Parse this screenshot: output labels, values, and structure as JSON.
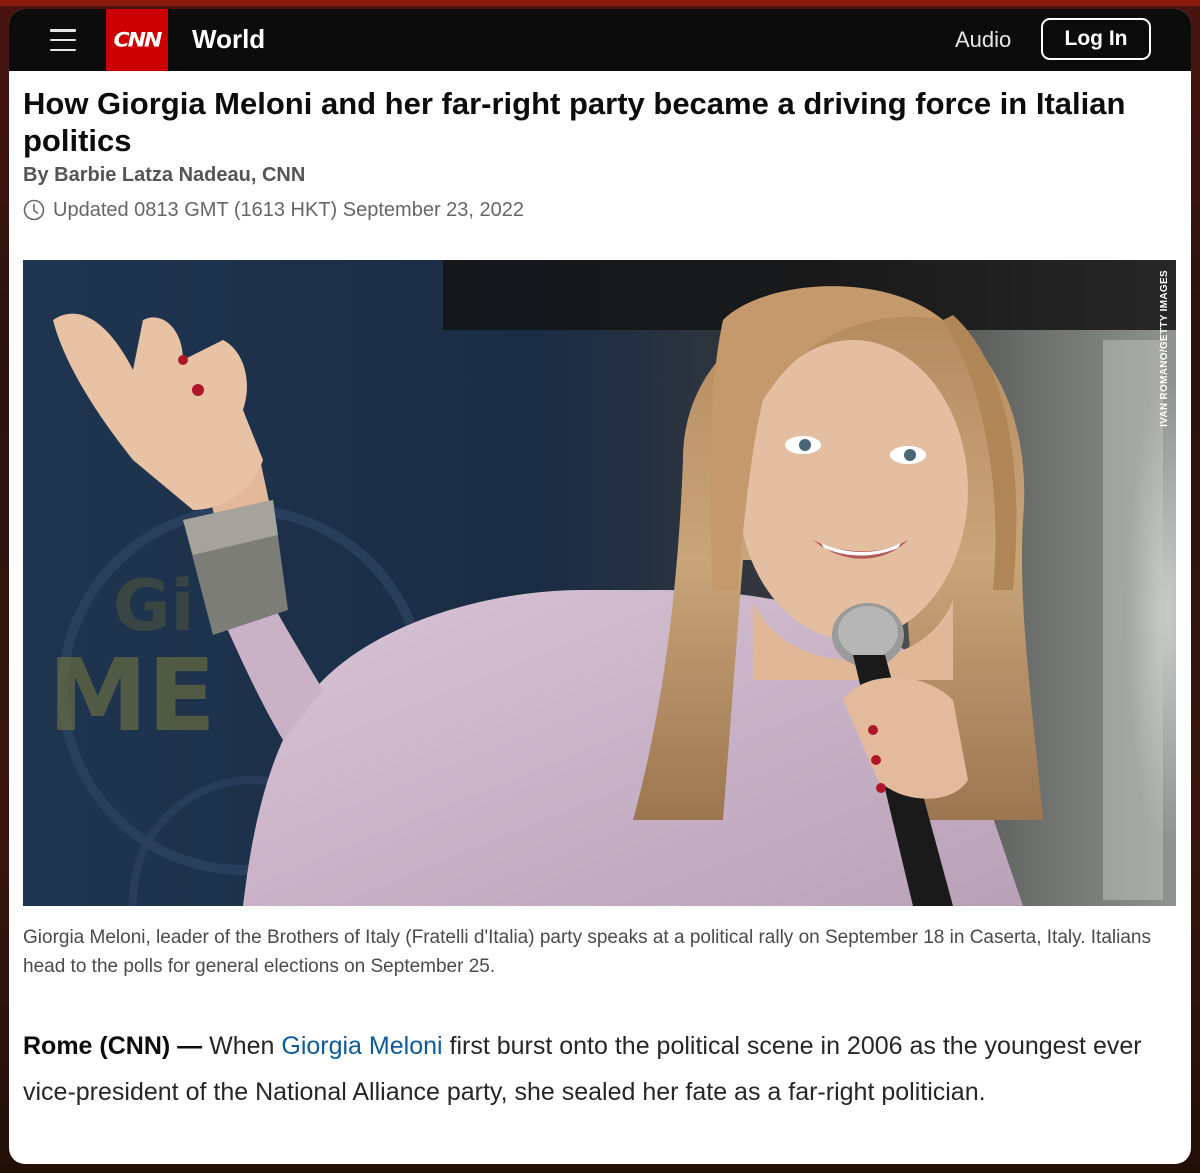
{
  "header": {
    "logo_text": "CNN",
    "section": "World",
    "audio_label": "Audio",
    "login_label": "Log In"
  },
  "article": {
    "headline": "How Giorgia Meloni and her far-right party became a driving force in Italian politics",
    "byline": "By Barbie Latza Nadeau, CNN",
    "updated": "Updated 0813 GMT (1613 HKT) September 23, 2022",
    "photo_credit": "IVAN ROMANO/GETTY IMAGES",
    "photo_description": "Woman with long blonde hair in a lilac sweater speaking into a microphone, raising her right hand, in front of a blue campaign backdrop",
    "caption": "Giorgia Meloni, leader of the Brothers of Italy (Fratelli d'Italia) party speaks at a political rally on September 18 in Caserta, Italy. Italians head to the polls for general elections on September 25.",
    "body": {
      "dateline": "Rome (CNN) —",
      "text_before_link": " When ",
      "link_text": "Giorgia Meloni",
      "text_after_link": " first burst onto the political scene in 2006 as the youngest ever vice-president of the National Alliance party, she sealed her fate as a far-right politician."
    }
  },
  "colors": {
    "brand_red": "#cc0000",
    "header_bg": "#0c0c0c",
    "link": "#0c5a9a"
  },
  "icons": {
    "menu": "hamburger-icon",
    "clock": "clock-icon"
  }
}
